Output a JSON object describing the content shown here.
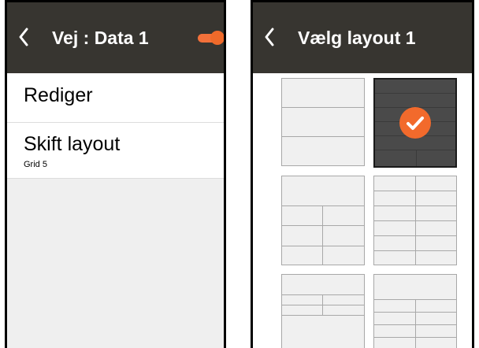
{
  "left_screen": {
    "title": "Vej : Data 1",
    "toggle_on": true,
    "menu": [
      {
        "label": "Rediger"
      },
      {
        "label": "Skift layout",
        "sublabel": "Grid 5"
      }
    ]
  },
  "right_screen": {
    "title": "Vælg layout  1",
    "selected_layout_index": 1
  },
  "colors": {
    "topbar": "#373530",
    "accent": "#f26a2c",
    "selected_tile": "#4a4a4a",
    "tile": "#f0f0f0"
  }
}
